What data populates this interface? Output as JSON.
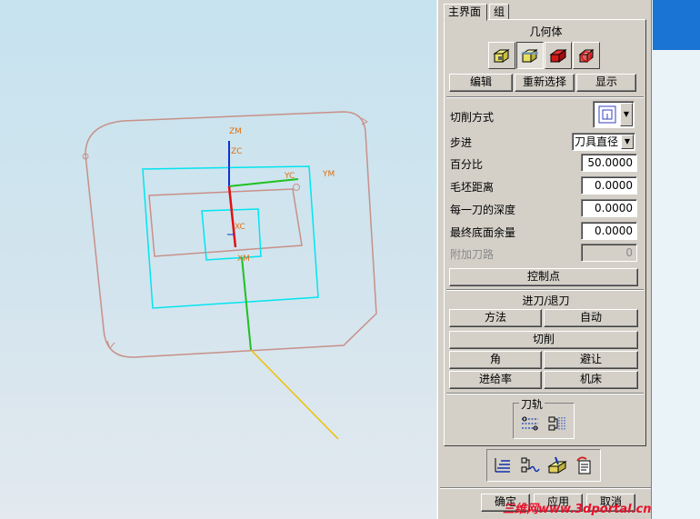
{
  "tabs": [
    {
      "label": "主界面",
      "active": true
    },
    {
      "label": "组",
      "active": false
    }
  ],
  "geometry": {
    "title": "几何体",
    "icons": [
      "part-geometry-icon",
      "blank-geometry-icon",
      "check-geometry-icon",
      "trim-geometry-icon"
    ],
    "buttons": {
      "edit": "编辑",
      "reselect": "重新选择",
      "display": "显示"
    }
  },
  "params": {
    "cut_pattern": {
      "label": "切削方式",
      "icon": "follow-periphery-icon"
    },
    "stepover": {
      "label": "步进",
      "value": "刀具直径"
    },
    "percent": {
      "label": "百分比",
      "value": "50.0000"
    },
    "blank_distance": {
      "label": "毛坯距离",
      "value": "0.0000"
    },
    "depth_per_cut": {
      "label": "每一刀的深度",
      "value": "0.0000"
    },
    "final_floor_stock": {
      "label": "最终底面余量",
      "value": "0.0000"
    },
    "additional_passes": {
      "label": "附加刀路",
      "value": "0"
    }
  },
  "control_points": "控制点",
  "engage": {
    "title": "进刀/退刀",
    "method": "方法",
    "auto": "自动"
  },
  "cutting": "切削",
  "corner": "角",
  "avoidance": "避让",
  "feedrates": "进给率",
  "machine": "机床",
  "toolpath": {
    "title": "刀轨",
    "icons": [
      "generate-toolpath-icon",
      "replay-toolpath-icon"
    ]
  },
  "action_icons": [
    "list-toolpath-icon",
    "verify-toolpath-icon",
    "machine-sim-icon",
    "output-postprocess-icon"
  ],
  "footer": {
    "ok": "确定",
    "apply": "应用",
    "cancel": "取消"
  },
  "watermark": "三维网www.3dportal.cn",
  "viewport": {
    "axis_labels": {
      "zm": "ZM",
      "zc": "ZC",
      "yc": "YC",
      "ym": "YM",
      "xc": "XC",
      "xm": "XM"
    }
  },
  "colors": {
    "dialog_bg": "#d4d0c8",
    "boundary": "#c89088",
    "blank": "#00e5f0",
    "axis_x": "#e01010",
    "axis_y": "#20c020",
    "axis_z": "#1030d0",
    "tool_axis": "#f0c000",
    "axis_label": "#e07010",
    "watermark": "#e8102a"
  }
}
